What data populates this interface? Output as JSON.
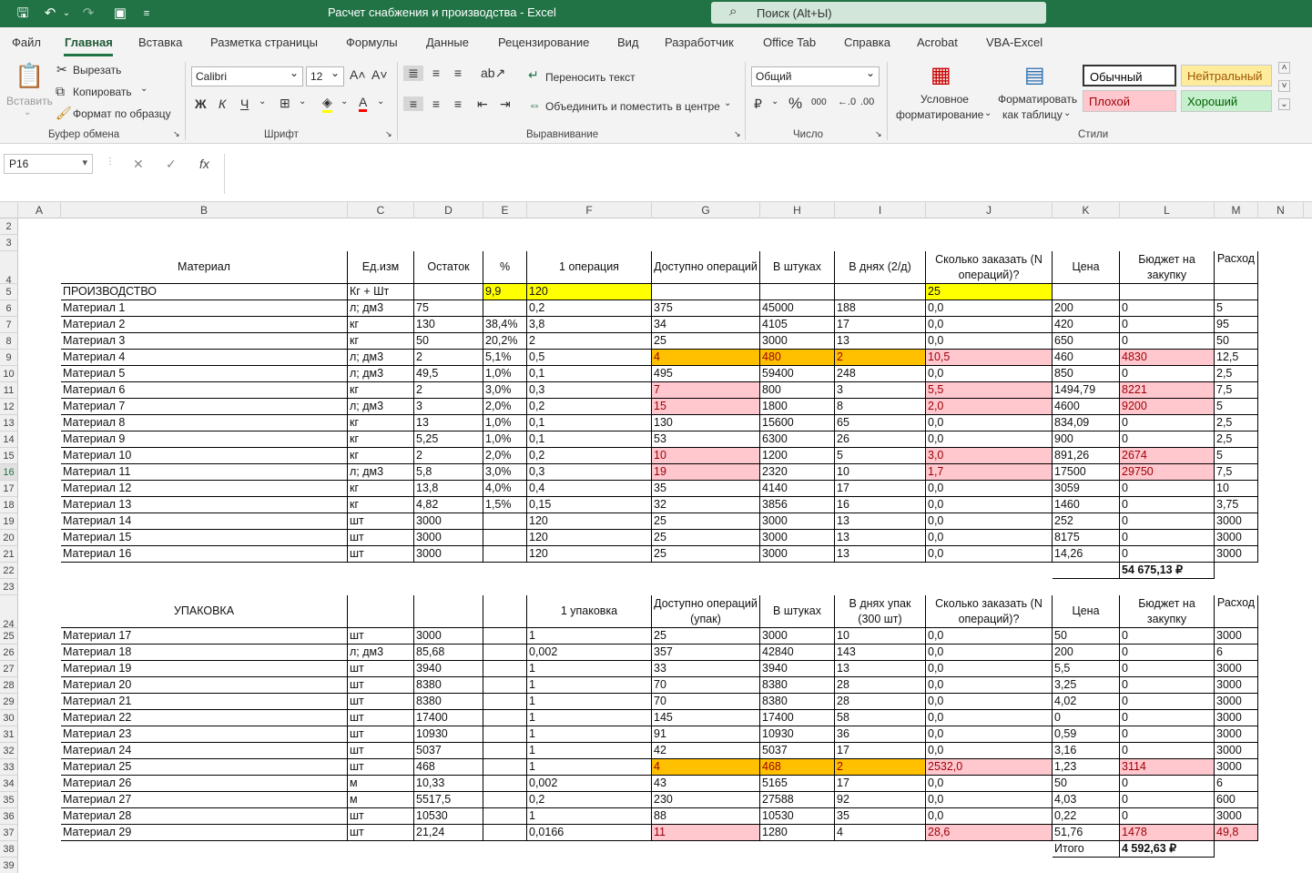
{
  "window": {
    "title": "Расчет снабжения и производства  -  Excel",
    "search_placeholder": "Поиск (Alt+Ы)"
  },
  "colors": {
    "accent": "#217346",
    "yellow": "#ffff00",
    "orange": "#ffc000",
    "bad_fill": "#ffc7ce",
    "bad_text": "#9c0006",
    "neutral_fill": "#ffeb9c",
    "good_fill": "#c6efce"
  },
  "menu": [
    "Файл",
    "Главная",
    "Вставка",
    "Разметка страницы",
    "Формулы",
    "Данные",
    "Рецензирование",
    "Вид",
    "Разработчик",
    "Office Tab",
    "Справка",
    "Acrobat",
    "VBA-Excel"
  ],
  "ribbon": {
    "clipboard": {
      "paste": "Вставить",
      "cut": "Вырезать",
      "copy": "Копировать",
      "format_painter": "Формат по образцу",
      "label": "Буфер обмена"
    },
    "font": {
      "name": "Calibri",
      "size": "12",
      "label": "Шрифт",
      "bold": "Ж",
      "italic": "К",
      "underline": "Ч"
    },
    "alignment": {
      "wrap": "Переносить текст",
      "merge": "Объединить и поместить в центре",
      "label": "Выравнивание"
    },
    "number": {
      "format": "Общий",
      "label": "Число"
    },
    "styles": {
      "conditional": "Условное\nформатирование",
      "cond_1": "Условное",
      "cond_2": "форматирование",
      "table_1": "Форматировать",
      "table_2": "как таблицу",
      "normal": "Обычный",
      "neutral": "Нейтральный",
      "bad": "Плохой",
      "good": "Хороший",
      "label": "Стили"
    }
  },
  "formula_bar": {
    "name_box": "P16",
    "formula": ""
  },
  "columns": [
    "A",
    "B",
    "C",
    "D",
    "E",
    "F",
    "G",
    "H",
    "I",
    "J",
    "K",
    "L",
    "M",
    "N"
  ],
  "rows": [
    2,
    3,
    4,
    5,
    6,
    7,
    8,
    9,
    10,
    11,
    12,
    13,
    14,
    15,
    16,
    17,
    18,
    19,
    20,
    21,
    22,
    23,
    24,
    25,
    26,
    27,
    28,
    29,
    30,
    31,
    32,
    33,
    34,
    35,
    36,
    37,
    38,
    39
  ],
  "selected_row": 16,
  "table1": {
    "headers": [
      "Материал",
      "Ед.изм",
      "Остаток",
      "%",
      "1 операция",
      "Доступно операций",
      "В штуках",
      "В днях (2/д)",
      "Сколько заказать (N операций)?",
      "Цена",
      "Бюджет на закупку",
      "Расход"
    ],
    "prod_row": [
      "ПРОИЗВОДСТВО",
      "Кг + Шт",
      "",
      "9,9",
      "120",
      "",
      "",
      "",
      "25",
      "",
      "",
      ""
    ],
    "rows": [
      [
        "Материал 1",
        "л; дм3",
        "75",
        "",
        "0,2",
        "375",
        "45000",
        "188",
        "0,0",
        "200",
        "0",
        "5"
      ],
      [
        "Материал 2",
        "кг",
        "130",
        "38,4%",
        "3,8",
        "34",
        "4105",
        "17",
        "0,0",
        "420",
        "0",
        "95"
      ],
      [
        "Материал 3",
        "кг",
        "50",
        "20,2%",
        "2",
        "25",
        "3000",
        "13",
        "0,0",
        "650",
        "0",
        "50"
      ],
      [
        "Материал 4",
        "л; дм3",
        "2",
        "5,1%",
        "0,5",
        "4",
        "480",
        "2",
        "10,5",
        "460",
        "4830",
        "12,5"
      ],
      [
        "Материал 5",
        "л; дм3",
        "49,5",
        "1,0%",
        "0,1",
        "495",
        "59400",
        "248",
        "0,0",
        "850",
        "0",
        "2,5"
      ],
      [
        "Материал 6",
        "кг",
        "2",
        "3,0%",
        "0,3",
        "7",
        "800",
        "3",
        "5,5",
        "1494,79",
        "8221",
        "7,5"
      ],
      [
        "Материал 7",
        "л; дм3",
        "3",
        "2,0%",
        "0,2",
        "15",
        "1800",
        "8",
        "2,0",
        "4600",
        "9200",
        "5"
      ],
      [
        "Материал 8",
        "кг",
        "13",
        "1,0%",
        "0,1",
        "130",
        "15600",
        "65",
        "0,0",
        "834,09",
        "0",
        "2,5"
      ],
      [
        "Материал 9",
        "кг",
        "5,25",
        "1,0%",
        "0,1",
        "53",
        "6300",
        "26",
        "0,0",
        "900",
        "0",
        "2,5"
      ],
      [
        "Материал 10",
        "кг",
        "2",
        "2,0%",
        "0,2",
        "10",
        "1200",
        "5",
        "3,0",
        "891,26",
        "2674",
        "5"
      ],
      [
        "Материал 11",
        "л; дм3",
        "5,8",
        "3,0%",
        "0,3",
        "19",
        "2320",
        "10",
        "1,7",
        "17500",
        "29750",
        "7,5"
      ],
      [
        "Материал 12",
        "кг",
        "13,8",
        "4,0%",
        "0,4",
        "35",
        "4140",
        "17",
        "0,0",
        "3059",
        "0",
        "10"
      ],
      [
        "Материал 13",
        "кг",
        "4,82",
        "1,5%",
        "0,15",
        "32",
        "3856",
        "16",
        "0,0",
        "1460",
        "0",
        "3,75"
      ],
      [
        "Материал 14",
        "шт",
        "3000",
        "",
        "120",
        "25",
        "3000",
        "13",
        "0,0",
        "252",
        "0",
        "3000"
      ],
      [
        "Материал 15",
        "шт",
        "3000",
        "",
        "120",
        "25",
        "3000",
        "13",
        "0,0",
        "8175",
        "0",
        "3000"
      ],
      [
        "Материал 16",
        "шт",
        "3000",
        "",
        "120",
        "25",
        "3000",
        "13",
        "0,0",
        "14,26",
        "0",
        "3000"
      ]
    ],
    "total": "54 675,13 ₽"
  },
  "table2": {
    "headers": [
      "УПАКОВКА",
      "",
      "",
      "",
      "1 упаковка",
      "Доступно операций (упак)",
      "В штуках",
      "В днях упак (300 шт)",
      "Сколько заказать (N операций)?",
      "Цена",
      "Бюджет на закупку",
      "Расход"
    ],
    "rows": [
      [
        "Материал 17",
        "шт",
        "3000",
        "",
        "1",
        "25",
        "3000",
        "10",
        "0,0",
        "50",
        "0",
        "3000"
      ],
      [
        "Материал 18",
        "л; дм3",
        "85,68",
        "",
        "0,002",
        "357",
        "42840",
        "143",
        "0,0",
        "200",
        "0",
        "6"
      ],
      [
        "Материал 19",
        "шт",
        "3940",
        "",
        "1",
        "33",
        "3940",
        "13",
        "0,0",
        "5,5",
        "0",
        "3000"
      ],
      [
        "Материал 20",
        "шт",
        "8380",
        "",
        "1",
        "70",
        "8380",
        "28",
        "0,0",
        "3,25",
        "0",
        "3000"
      ],
      [
        "Материал 21",
        "шт",
        "8380",
        "",
        "1",
        "70",
        "8380",
        "28",
        "0,0",
        "4,02",
        "0",
        "3000"
      ],
      [
        "Материал 22",
        "шт",
        "17400",
        "",
        "1",
        "145",
        "17400",
        "58",
        "0,0",
        "0",
        "0",
        "3000"
      ],
      [
        "Материал 23",
        "шт",
        "10930",
        "",
        "1",
        "91",
        "10930",
        "36",
        "0,0",
        "0,59",
        "0",
        "3000"
      ],
      [
        "Материал 24",
        "шт",
        "5037",
        "",
        "1",
        "42",
        "5037",
        "17",
        "0,0",
        "3,16",
        "0",
        "3000"
      ],
      [
        "Материал 25",
        "шт",
        "468",
        "",
        "1",
        "4",
        "468",
        "2",
        "2532,0",
        "1,23",
        "3114",
        "3000"
      ],
      [
        "Материал 26",
        "м",
        "10,33",
        "",
        "0,002",
        "43",
        "5165",
        "17",
        "0,0",
        "50",
        "0",
        "6"
      ],
      [
        "Материал 27",
        "м",
        "5517,5",
        "",
        "0,2",
        "230",
        "27588",
        "92",
        "0,0",
        "4,03",
        "0",
        "600"
      ],
      [
        "Материал 28",
        "шт",
        "10530",
        "",
        "1",
        "88",
        "10530",
        "35",
        "0,0",
        "0,22",
        "0",
        "3000"
      ],
      [
        "Материал 29",
        "шт",
        "21,24",
        "",
        "0,0166",
        "11",
        "1280",
        "4",
        "28,6",
        "51,76",
        "1478",
        "49,8"
      ]
    ],
    "total_label": "Итого",
    "total": "4 592,63 ₽"
  }
}
